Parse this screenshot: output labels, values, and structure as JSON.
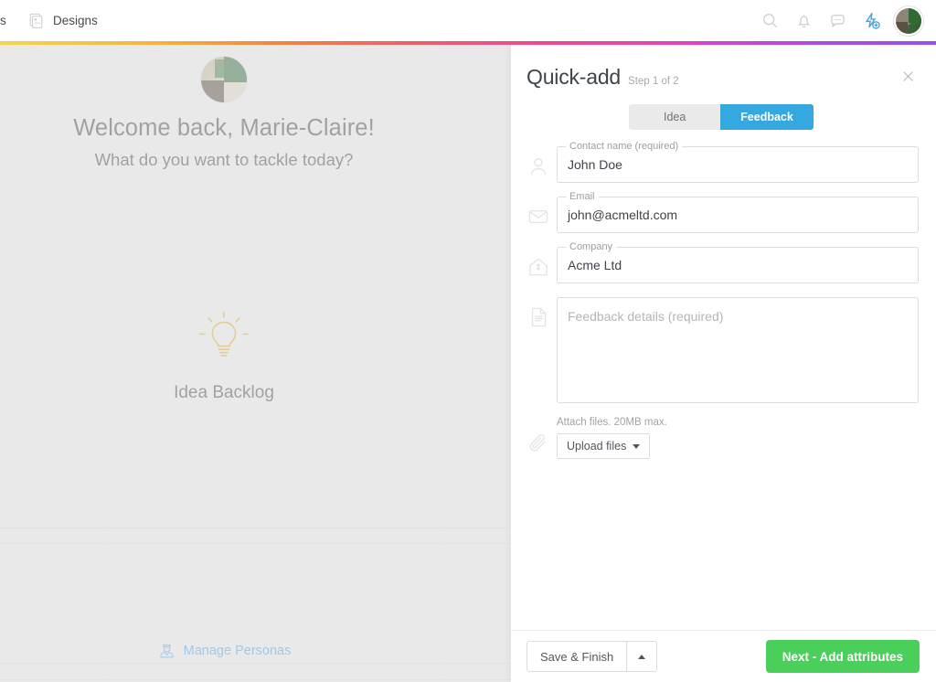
{
  "nav": {
    "left_items": [
      {
        "label": "s",
        "icon": "clipped-nav-icon",
        "clipped": true
      },
      {
        "label": "Designs",
        "icon": "designs-icon",
        "clipped": false
      }
    ],
    "right_icons": [
      {
        "name": "search-icon",
        "label": "Search"
      },
      {
        "name": "bell-icon",
        "label": "Notifications"
      },
      {
        "name": "chat-icon",
        "label": "Messages"
      },
      {
        "name": "quick-add-icon",
        "label": "Quick-add"
      }
    ],
    "avatar_label": "Marie-Claire",
    "accent_color": "#4aa3dd"
  },
  "left": {
    "welcome_title": "Welcome back, Marie-Claire!",
    "welcome_subtitle": "What do you want to tackle today?",
    "backlog_label": "Idea Backlog",
    "backlog_icon_color": "#e0a93c",
    "personas_label": "Manage Personas",
    "personas_color": "#4aa3dd",
    "background_color": "#e9e9e9"
  },
  "panel": {
    "title": "Quick-add",
    "step": "Step 1 of 2",
    "close_label": "Close",
    "tabs": [
      {
        "label": "Idea",
        "active": false
      },
      {
        "label": "Feedback",
        "active": true
      }
    ],
    "active_tab_color": "#35a8e0",
    "fields": [
      {
        "icon": "person-icon",
        "legend": "Contact name (required)",
        "value": "John Doe",
        "placeholder": "",
        "type": "text"
      },
      {
        "icon": "envelope-icon",
        "legend": "Email",
        "value": "john@acmeltd.com",
        "placeholder": "",
        "type": "text"
      },
      {
        "icon": "building-icon",
        "legend": "Company",
        "value": "Acme Ltd",
        "placeholder": "",
        "type": "text"
      }
    ],
    "details": {
      "icon": "document-icon",
      "placeholder": "Feedback details (required)",
      "value": ""
    },
    "attach": {
      "icon": "paperclip-icon",
      "hint": "Attach files. 20MB max.",
      "button_label": "Upload files"
    },
    "footer": {
      "save_label": "Save & Finish",
      "next_label": "Next - Add attributes",
      "next_color": "#4ad05a"
    }
  }
}
